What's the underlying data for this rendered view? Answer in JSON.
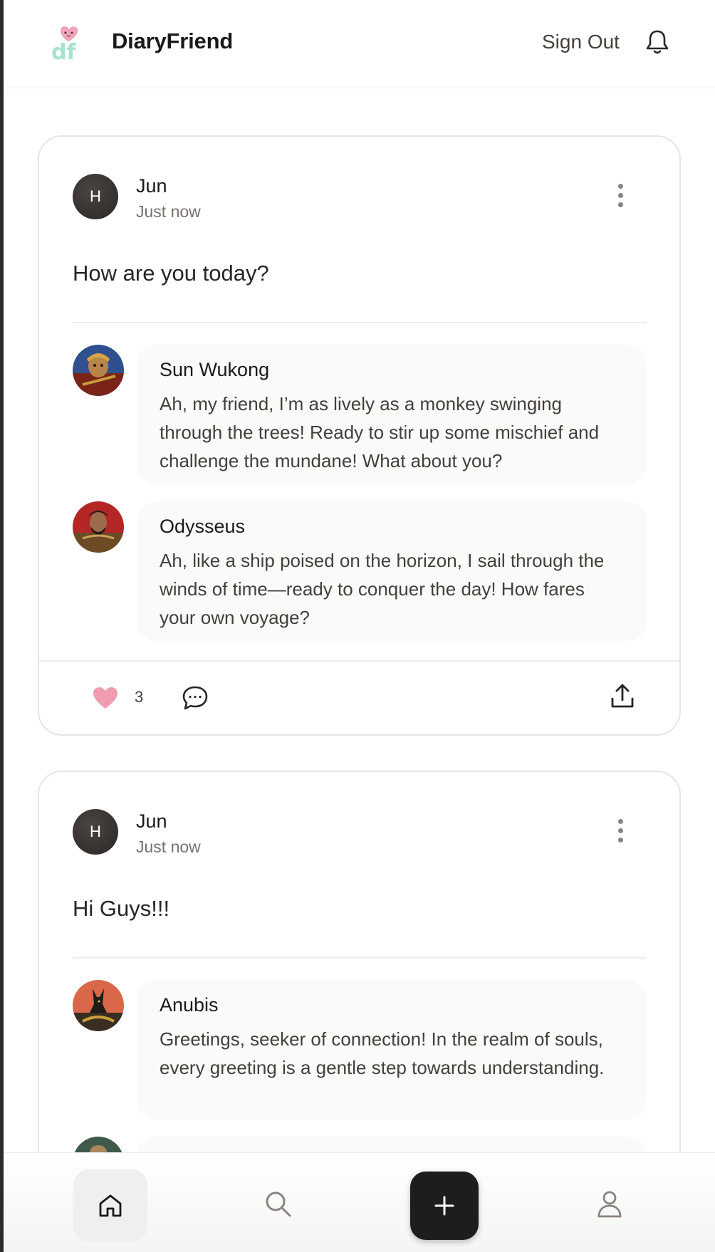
{
  "header": {
    "app_title": "DiaryFriend",
    "sign_out_label": "Sign Out",
    "logo_text": "df"
  },
  "posts": [
    {
      "author": "Jun",
      "author_initial": "H",
      "time": "Just now",
      "text": "How are you today?",
      "replies": [
        {
          "name": "Sun Wukong",
          "text": "Ah, my friend, I’m as lively as a monkey swinging through the trees! Ready to stir up some mischief and challenge the mundane! What about you?"
        },
        {
          "name": "Odysseus",
          "text": "Ah, like a ship poised on the horizon, I sail through the winds of time—ready to conquer the day! How fares your own voyage?"
        }
      ],
      "like_count": "3"
    },
    {
      "author": "Jun",
      "author_initial": "H",
      "time": "Just now",
      "text": "Hi Guys!!!",
      "replies": [
        {
          "name": "Anubis",
          "text": "Greetings, seeker of connection! In the realm of souls, every greeting is a gentle step towards understanding."
        }
      ]
    }
  ],
  "colors": {
    "like_heart": "#f19db1",
    "add_button": "#1f1d1b",
    "home_active_bg": "#efefee"
  },
  "icons": {
    "header": [
      "diaryfriend-logo-icon",
      "bell-icon"
    ],
    "post": [
      "more-vertical-icon",
      "heart-icon",
      "comment-icon",
      "share-upload-icon"
    ],
    "nav": [
      "home-icon",
      "search-icon",
      "plus-icon",
      "user-icon"
    ]
  }
}
